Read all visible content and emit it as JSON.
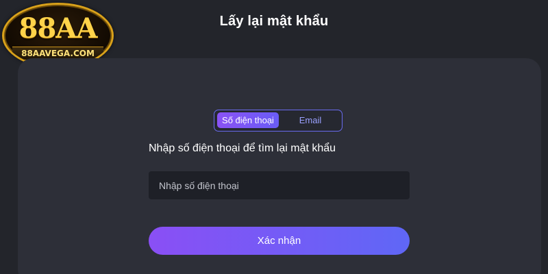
{
  "header": {
    "title": "Lấy lại mật khẩu",
    "logo": {
      "brand": "88AA",
      "site": "88AAVEGA.COM",
      "colors": {
        "gold": "#ffd34a",
        "border": "#d9a11a"
      }
    }
  },
  "tabs": [
    {
      "label": "Số điện thoại",
      "active": true
    },
    {
      "label": "Email",
      "active": false
    }
  ],
  "form": {
    "instruction": "Nhập số điện thoại để tìm lại mật khẩu",
    "phone_placeholder": "Nhập số điện thoại",
    "phone_value": "",
    "submit_label": "Xác nhận"
  },
  "colors": {
    "background": "#23252b",
    "card": "#2d2f38",
    "input": "#1e2027",
    "accent_start": "#8a4ff5",
    "accent_end": "#5f67f6",
    "tab_border": "#6a6cf0",
    "tab_inactive_text": "#9aa0ff"
  }
}
